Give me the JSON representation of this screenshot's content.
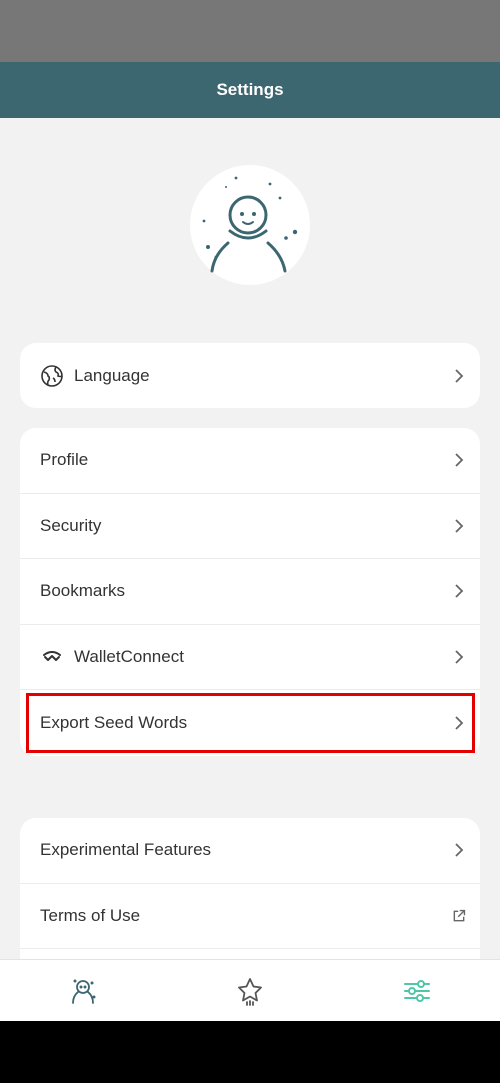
{
  "header": {
    "title": "Settings"
  },
  "settings": {
    "language": {
      "label": "Language"
    },
    "items": [
      {
        "label": "Profile"
      },
      {
        "label": "Security"
      },
      {
        "label": "Bookmarks"
      },
      {
        "label": "WalletConnect"
      },
      {
        "label": "Export Seed Words"
      }
    ],
    "more": [
      {
        "label": "Experimental Features"
      },
      {
        "label": "Terms of Use"
      }
    ]
  },
  "tabs": [
    {
      "name": "profile",
      "active": false
    },
    {
      "name": "favorites",
      "active": false
    },
    {
      "name": "settings",
      "active": true
    }
  ],
  "colors": {
    "header": "#3c6670",
    "accent_active": "#4fc7a6",
    "highlight": "#e50000"
  },
  "icons": [
    "avatar-illustration",
    "globe-icon",
    "walletconnect-icon",
    "chevron-right-icon",
    "external-link-icon",
    "user-tab-icon",
    "star-tab-icon",
    "sliders-tab-icon"
  ]
}
